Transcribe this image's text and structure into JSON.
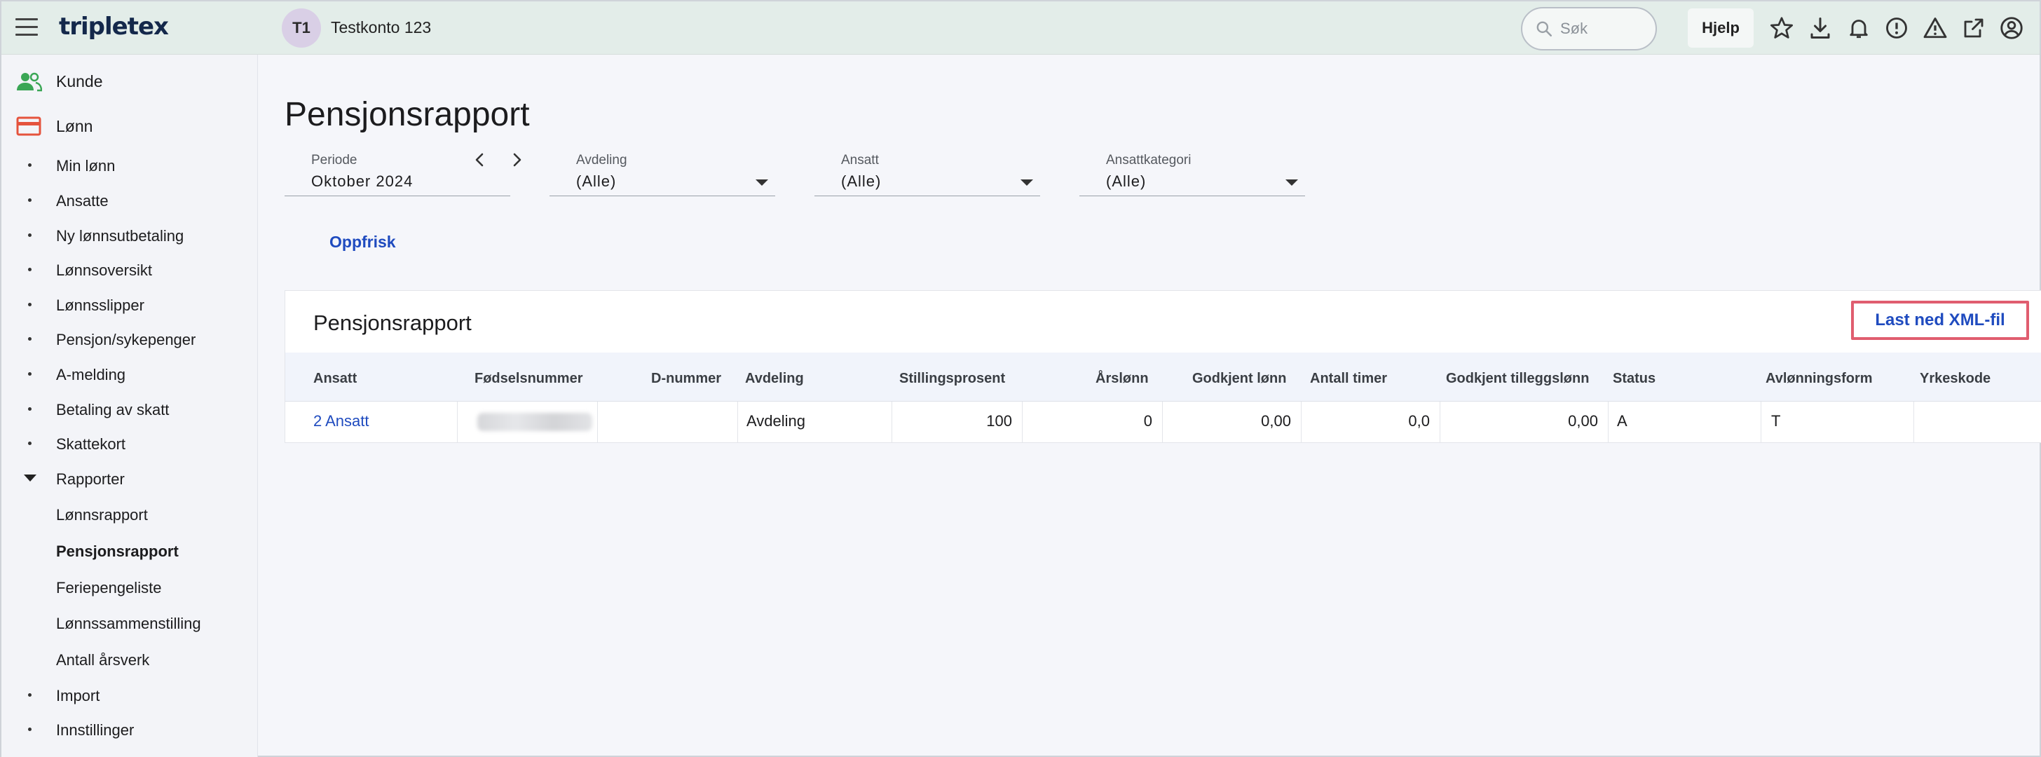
{
  "header": {
    "logo": "tripletex",
    "account_initials": "T1",
    "account_name": "Testkonto 123",
    "search_placeholder": "Søk",
    "help_label": "Hjelp",
    "icons": [
      "star-icon",
      "download-icon",
      "bell-icon",
      "info-circle-icon",
      "warning-icon",
      "external-link-icon",
      "user-circle-icon"
    ]
  },
  "sidebar": {
    "top_items": [
      {
        "label": "Kunde",
        "icon": "users-icon",
        "color": "#3aa655"
      },
      {
        "label": "Lønn",
        "icon": "credit-card-icon",
        "color": "#e5533d"
      }
    ],
    "items": [
      {
        "label": "Min lønn"
      },
      {
        "label": "Ansatte"
      },
      {
        "label": "Ny lønnsutbetaling"
      },
      {
        "label": "Lønnsoversikt"
      },
      {
        "label": "Lønnsslipper"
      },
      {
        "label": "Pensjon/sykepenger"
      },
      {
        "label": "A-melding"
      },
      {
        "label": "Betaling av skatt"
      },
      {
        "label": "Skattekort"
      },
      {
        "label": "Rapporter",
        "expanded": true
      }
    ],
    "sub_items": [
      {
        "label": "Lønnsrapport"
      },
      {
        "label": "Pensjonsrapport",
        "active": true
      },
      {
        "label": "Feriepengeliste"
      },
      {
        "label": "Lønnssammenstilling"
      },
      {
        "label": "Antall årsverk"
      }
    ],
    "bottom_items": [
      {
        "label": "Import"
      },
      {
        "label": "Innstillinger"
      }
    ]
  },
  "main": {
    "title": "Pensjonsrapport",
    "filters": {
      "periode": {
        "label": "Periode",
        "value": "Oktober 2024"
      },
      "avdeling": {
        "label": "Avdeling",
        "value": "(Alle)"
      },
      "ansatt": {
        "label": "Ansatt",
        "value": "(Alle)"
      },
      "ansattkategori": {
        "label": "Ansattkategori",
        "value": "(Alle)"
      }
    },
    "refresh_label": "Oppfrisk",
    "report": {
      "title": "Pensjonsrapport",
      "download_label": "Last ned XML-fil",
      "columns": [
        "Ansatt",
        "Fødselsnummer",
        "D-nummer",
        "Avdeling",
        "Stillingsprosent",
        "Årslønn",
        "Godkjent lønn",
        "Antall timer",
        "Godkjent tilleggslønn",
        "Status",
        "Avlønningsform",
        "Yrkeskode"
      ],
      "rows": [
        {
          "ansatt": "2 Ansatt",
          "fodselsnummer": "",
          "d_nummer": "",
          "avdeling": "Avdeling",
          "stillingsprosent": "100",
          "arslonn": "0",
          "godkjent_lonn": "0,00",
          "antall_timer": "0,0",
          "godkjent_tilleggslonn": "0,00",
          "status": "A",
          "avlonningsform": "T",
          "yrkeskode": ""
        }
      ]
    }
  },
  "colors": {
    "accent": "#1f4bbf",
    "topbar": "#e3ede9",
    "highlight": "#e05d6f"
  }
}
